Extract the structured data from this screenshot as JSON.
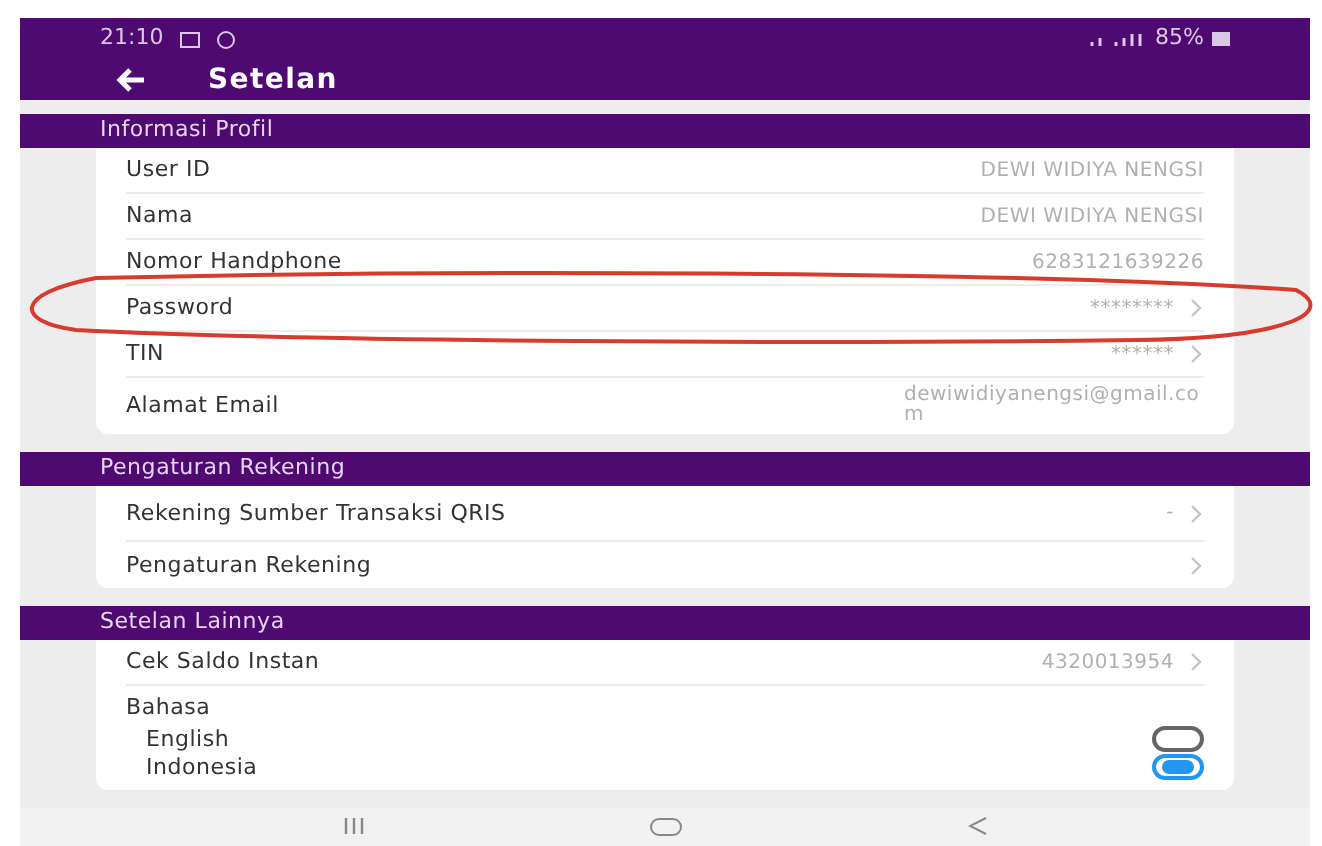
{
  "status_bar": {
    "time": "21:10",
    "battery": "85%"
  },
  "app_bar": {
    "title": "Setelan"
  },
  "sections": [
    {
      "title": "Informasi Profil",
      "rows": [
        {
          "kind": "value",
          "label": "User ID",
          "value": "DEWI WIDIYA NENGSI",
          "chevron": false
        },
        {
          "kind": "value",
          "label": "Nama",
          "value": "DEWI WIDIYA NENGSI",
          "chevron": false
        },
        {
          "kind": "value",
          "label": "Nomor Handphone",
          "value": "6283121639226",
          "chevron": false
        },
        {
          "kind": "value",
          "label": "Password",
          "value": "********",
          "chevron": true,
          "circled": true
        },
        {
          "kind": "value",
          "label": "TIN",
          "value": "******",
          "chevron": true
        },
        {
          "kind": "value",
          "label": "Alamat Email",
          "value": "dewiwidiyanengsi@gmail.com",
          "chevron": false
        }
      ]
    },
    {
      "title": "Pengaturan Rekening",
      "rows": [
        {
          "kind": "value",
          "label": "Rekening Sumber Transaksi QRIS",
          "value": "-",
          "chevron": true
        },
        {
          "kind": "value",
          "label": "Pengaturan Rekening",
          "chevron": true
        }
      ]
    },
    {
      "title": "Setelan Lainnya",
      "rows": [
        {
          "kind": "value",
          "label": "Cek Saldo Instan",
          "value": "4320013954",
          "chevron": true
        },
        {
          "kind": "radio",
          "label": "Bahasa",
          "options": [
            {
              "label": "English",
              "selected": false
            },
            {
              "label": "Indonesia",
              "selected": true
            }
          ]
        }
      ]
    }
  ]
}
